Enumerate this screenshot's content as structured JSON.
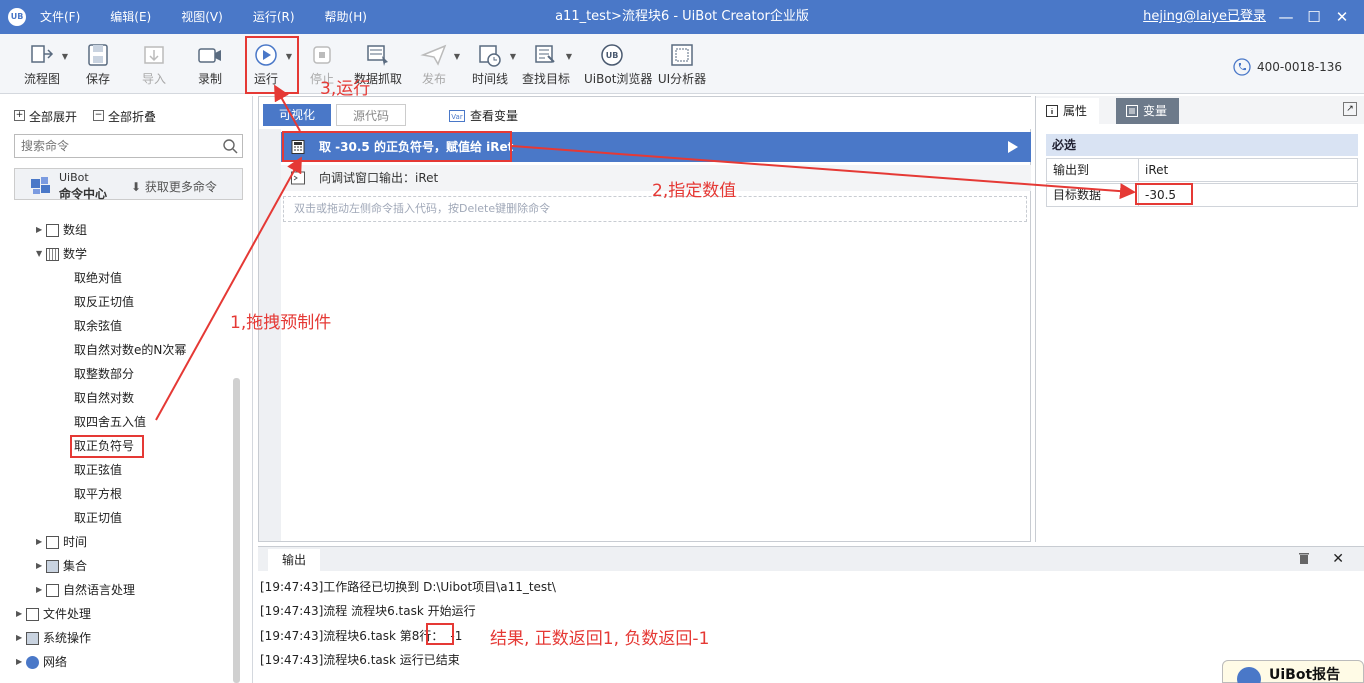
{
  "app": {
    "logo": "UB",
    "menu": [
      "文件(F)",
      "编辑(E)",
      "视图(V)",
      "运行(R)",
      "帮助(H)"
    ],
    "window_title": "a11_test>流程块6 - UiBot Creator企业版",
    "user": "hejing@laiye已登录",
    "win_buttons": [
      "—",
      "☐",
      "✕"
    ]
  },
  "toolbar": {
    "items": [
      {
        "label": "流程图",
        "icon": "flowchart-icon",
        "dropdown": true,
        "enabled": true
      },
      {
        "label": "保存",
        "icon": "save-icon",
        "dropdown": false,
        "enabled": true
      },
      {
        "label": "导入",
        "icon": "import-icon",
        "dropdown": false,
        "enabled": false
      },
      {
        "label": "录制",
        "icon": "record-icon",
        "dropdown": false,
        "enabled": true
      },
      {
        "label": "运行",
        "icon": "run-icon",
        "dropdown": true,
        "enabled": true
      },
      {
        "label": "停止",
        "icon": "stop-icon",
        "dropdown": false,
        "enabled": false
      },
      {
        "label": "数据抓取",
        "icon": "data-capture-icon",
        "dropdown": false,
        "enabled": true
      },
      {
        "label": "发布",
        "icon": "publish-icon",
        "dropdown": true,
        "enabled": false
      },
      {
        "label": "时间线",
        "icon": "timeline-icon",
        "dropdown": true,
        "enabled": true
      },
      {
        "label": "查找目标",
        "icon": "find-target-icon",
        "dropdown": true,
        "enabled": true
      },
      {
        "label": "UiBot浏览器",
        "icon": "uibot-browser-icon",
        "dropdown": false,
        "enabled": true
      },
      {
        "label": "UI分析器",
        "icon": "ui-analyzer-icon",
        "dropdown": false,
        "enabled": true
      }
    ],
    "hotline": "400-0018-136"
  },
  "left": {
    "expand_all": "全部展开",
    "collapse_all": "全部折叠",
    "search_placeholder": "搜索命令",
    "cmd_center_line1": "UiBot",
    "cmd_center_line2": "命令中心",
    "cmd_center_more": "获取更多命令",
    "tree": [
      {
        "label": "数组",
        "level": 1,
        "expanded": false
      },
      {
        "label": "数学",
        "level": 1,
        "expanded": true
      },
      {
        "label": "取绝对值",
        "level": 2
      },
      {
        "label": "取反正切值",
        "level": 2
      },
      {
        "label": "取余弦值",
        "level": 2
      },
      {
        "label": "取自然对数e的N次幂",
        "level": 2
      },
      {
        "label": "取整数部分",
        "level": 2
      },
      {
        "label": "取自然对数",
        "level": 2
      },
      {
        "label": "取四舍五入值",
        "level": 2
      },
      {
        "label": "取正负符号",
        "level": 2,
        "highlighted": true
      },
      {
        "label": "取正弦值",
        "level": 2
      },
      {
        "label": "取平方根",
        "level": 2
      },
      {
        "label": "取正切值",
        "level": 2
      },
      {
        "label": "时间",
        "level": 1,
        "expanded": false
      },
      {
        "label": "集合",
        "level": 1,
        "expanded": false
      },
      {
        "label": "自然语言处理",
        "level": 1,
        "expanded": false
      },
      {
        "label": "文件处理",
        "level": 0,
        "expanded": false
      },
      {
        "label": "系统操作",
        "level": 0,
        "expanded": false
      },
      {
        "label": "网络",
        "level": 0,
        "expanded": false
      }
    ]
  },
  "editor": {
    "tab_visual": "可视化",
    "tab_source": "源代码",
    "view_vars": "查看变量",
    "statements": [
      {
        "text": "取 -30.5 的正负符号，赋值给 iRet",
        "selected": true
      },
      {
        "text": "向调试窗口输出：iRet",
        "selected": false
      }
    ],
    "placeholder": "双击或拖动左侧命令插入代码，按Delete键删除命令"
  },
  "props": {
    "tab_props": "属性",
    "tab_vars": "变量",
    "section": "必选",
    "rows": [
      {
        "key": "输出到",
        "value": "iRet"
      },
      {
        "key": "目标数据",
        "value": "-30.5"
      }
    ]
  },
  "output": {
    "tab": "输出",
    "lines": [
      {
        "text": "[19:47:43]工作路径已切换到 D:\\Uibot项目\\a11_test\\",
        "value": ""
      },
      {
        "text": "[19:47:43]流程 流程块6.task 开始运行",
        "value": ""
      },
      {
        "text": "[19:47:43]流程块6.task 第8行：",
        "value": "-1"
      },
      {
        "text": "[19:47:43]流程块6.task 运行已结束",
        "value": ""
      }
    ]
  },
  "annotations": {
    "step1": "1,拖拽预制件",
    "step2": "2,指定数值",
    "step3": "3,运行",
    "result": "结果, 正数返回1, 负数返回-1"
  },
  "report": {
    "label": "UiBot报告"
  },
  "colors": {
    "accent": "#4a78c8",
    "annotation": "#e53935"
  }
}
